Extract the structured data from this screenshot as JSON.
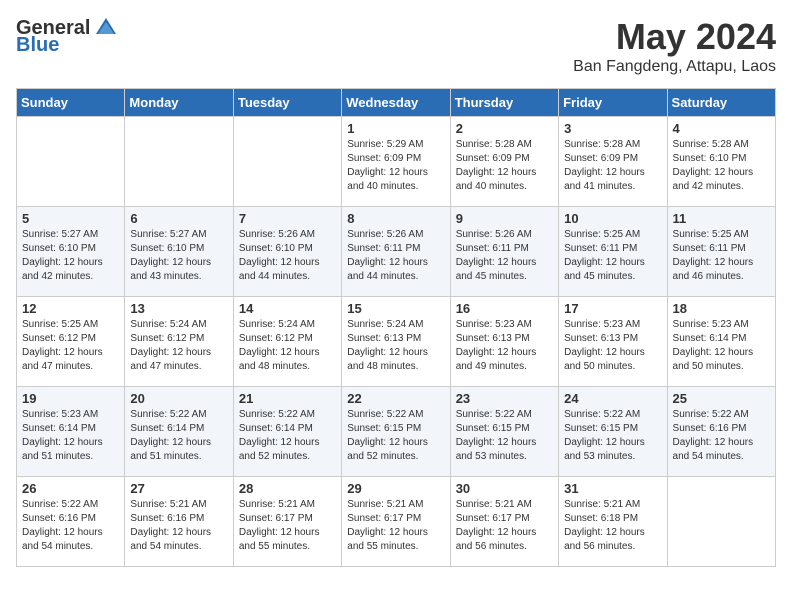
{
  "logo": {
    "general": "General",
    "blue": "Blue"
  },
  "title": {
    "month": "May 2024",
    "location": "Ban Fangdeng, Attapu, Laos"
  },
  "weekdays": [
    "Sunday",
    "Monday",
    "Tuesday",
    "Wednesday",
    "Thursday",
    "Friday",
    "Saturday"
  ],
  "weeks": [
    [
      {
        "day": "",
        "info": ""
      },
      {
        "day": "",
        "info": ""
      },
      {
        "day": "",
        "info": ""
      },
      {
        "day": "1",
        "info": "Sunrise: 5:29 AM\nSunset: 6:09 PM\nDaylight: 12 hours\nand 40 minutes."
      },
      {
        "day": "2",
        "info": "Sunrise: 5:28 AM\nSunset: 6:09 PM\nDaylight: 12 hours\nand 40 minutes."
      },
      {
        "day": "3",
        "info": "Sunrise: 5:28 AM\nSunset: 6:09 PM\nDaylight: 12 hours\nand 41 minutes."
      },
      {
        "day": "4",
        "info": "Sunrise: 5:28 AM\nSunset: 6:10 PM\nDaylight: 12 hours\nand 42 minutes."
      }
    ],
    [
      {
        "day": "5",
        "info": "Sunrise: 5:27 AM\nSunset: 6:10 PM\nDaylight: 12 hours\nand 42 minutes."
      },
      {
        "day": "6",
        "info": "Sunrise: 5:27 AM\nSunset: 6:10 PM\nDaylight: 12 hours\nand 43 minutes."
      },
      {
        "day": "7",
        "info": "Sunrise: 5:26 AM\nSunset: 6:10 PM\nDaylight: 12 hours\nand 44 minutes."
      },
      {
        "day": "8",
        "info": "Sunrise: 5:26 AM\nSunset: 6:11 PM\nDaylight: 12 hours\nand 44 minutes."
      },
      {
        "day": "9",
        "info": "Sunrise: 5:26 AM\nSunset: 6:11 PM\nDaylight: 12 hours\nand 45 minutes."
      },
      {
        "day": "10",
        "info": "Sunrise: 5:25 AM\nSunset: 6:11 PM\nDaylight: 12 hours\nand 45 minutes."
      },
      {
        "day": "11",
        "info": "Sunrise: 5:25 AM\nSunset: 6:11 PM\nDaylight: 12 hours\nand 46 minutes."
      }
    ],
    [
      {
        "day": "12",
        "info": "Sunrise: 5:25 AM\nSunset: 6:12 PM\nDaylight: 12 hours\nand 47 minutes."
      },
      {
        "day": "13",
        "info": "Sunrise: 5:24 AM\nSunset: 6:12 PM\nDaylight: 12 hours\nand 47 minutes."
      },
      {
        "day": "14",
        "info": "Sunrise: 5:24 AM\nSunset: 6:12 PM\nDaylight: 12 hours\nand 48 minutes."
      },
      {
        "day": "15",
        "info": "Sunrise: 5:24 AM\nSunset: 6:13 PM\nDaylight: 12 hours\nand 48 minutes."
      },
      {
        "day": "16",
        "info": "Sunrise: 5:23 AM\nSunset: 6:13 PM\nDaylight: 12 hours\nand 49 minutes."
      },
      {
        "day": "17",
        "info": "Sunrise: 5:23 AM\nSunset: 6:13 PM\nDaylight: 12 hours\nand 50 minutes."
      },
      {
        "day": "18",
        "info": "Sunrise: 5:23 AM\nSunset: 6:14 PM\nDaylight: 12 hours\nand 50 minutes."
      }
    ],
    [
      {
        "day": "19",
        "info": "Sunrise: 5:23 AM\nSunset: 6:14 PM\nDaylight: 12 hours\nand 51 minutes."
      },
      {
        "day": "20",
        "info": "Sunrise: 5:22 AM\nSunset: 6:14 PM\nDaylight: 12 hours\nand 51 minutes."
      },
      {
        "day": "21",
        "info": "Sunrise: 5:22 AM\nSunset: 6:14 PM\nDaylight: 12 hours\nand 52 minutes."
      },
      {
        "day": "22",
        "info": "Sunrise: 5:22 AM\nSunset: 6:15 PM\nDaylight: 12 hours\nand 52 minutes."
      },
      {
        "day": "23",
        "info": "Sunrise: 5:22 AM\nSunset: 6:15 PM\nDaylight: 12 hours\nand 53 minutes."
      },
      {
        "day": "24",
        "info": "Sunrise: 5:22 AM\nSunset: 6:15 PM\nDaylight: 12 hours\nand 53 minutes."
      },
      {
        "day": "25",
        "info": "Sunrise: 5:22 AM\nSunset: 6:16 PM\nDaylight: 12 hours\nand 54 minutes."
      }
    ],
    [
      {
        "day": "26",
        "info": "Sunrise: 5:22 AM\nSunset: 6:16 PM\nDaylight: 12 hours\nand 54 minutes."
      },
      {
        "day": "27",
        "info": "Sunrise: 5:21 AM\nSunset: 6:16 PM\nDaylight: 12 hours\nand 54 minutes."
      },
      {
        "day": "28",
        "info": "Sunrise: 5:21 AM\nSunset: 6:17 PM\nDaylight: 12 hours\nand 55 minutes."
      },
      {
        "day": "29",
        "info": "Sunrise: 5:21 AM\nSunset: 6:17 PM\nDaylight: 12 hours\nand 55 minutes."
      },
      {
        "day": "30",
        "info": "Sunrise: 5:21 AM\nSunset: 6:17 PM\nDaylight: 12 hours\nand 56 minutes."
      },
      {
        "day": "31",
        "info": "Sunrise: 5:21 AM\nSunset: 6:18 PM\nDaylight: 12 hours\nand 56 minutes."
      },
      {
        "day": "",
        "info": ""
      }
    ]
  ]
}
